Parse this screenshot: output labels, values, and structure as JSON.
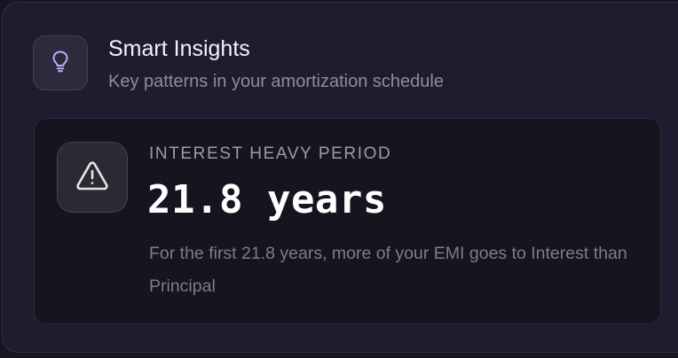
{
  "header": {
    "icon": "lightbulb-icon",
    "title": "Smart Insights",
    "subtitle": "Key patterns in your amortization schedule"
  },
  "insight": {
    "icon": "warning-triangle-icon",
    "label": "INTEREST HEAVY PERIOD",
    "value": "21.8 years",
    "description": "For the first 21.8 years, more of your EMI goes to Interest than Principal"
  },
  "colors": {
    "accent": "#c7a6ff",
    "panel_background": "#1f1c2f",
    "card_background": "#16141f"
  }
}
